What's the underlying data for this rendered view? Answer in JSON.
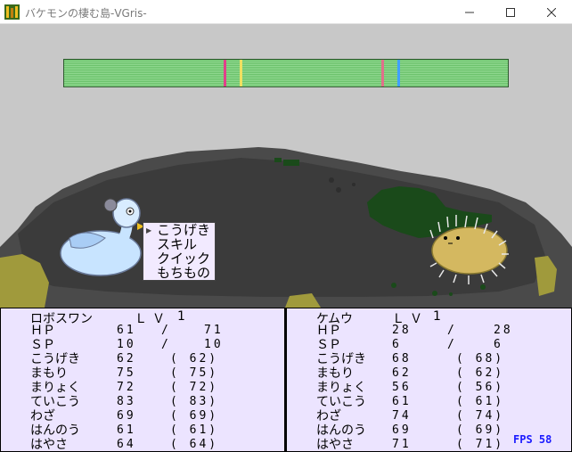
{
  "window": {
    "title": "バケモンの棲む島-VGris-"
  },
  "battle_menu": {
    "items": [
      "こうげき",
      "スキル",
      "クイック",
      "もちもの"
    ],
    "selected_index": 0
  },
  "player": {
    "name": "ロボスワン",
    "level_label": "ＬＶ",
    "level": "1",
    "stats": [
      {
        "label": "ＨＰ",
        "current": "61",
        "sep": "/",
        "max": "71"
      },
      {
        "label": "ＳＰ",
        "current": "10",
        "sep": "/",
        "max": "10"
      },
      {
        "label": "こうげき",
        "current": "62",
        "base": "( 62)"
      },
      {
        "label": "まもり",
        "current": "75",
        "base": "( 75)"
      },
      {
        "label": "まりょく",
        "current": "72",
        "base": "( 72)"
      },
      {
        "label": "ていこう",
        "current": "83",
        "base": "( 83)"
      },
      {
        "label": "わざ",
        "current": "69",
        "base": "( 69)"
      },
      {
        "label": "はんのう",
        "current": "61",
        "base": "( 61)"
      },
      {
        "label": "はやさ",
        "current": "64",
        "base": "( 64)"
      }
    ]
  },
  "enemy": {
    "name": "ケムウ",
    "level_label": "ＬＶ",
    "level": "1",
    "stats": [
      {
        "label": "ＨＰ",
        "current": "28",
        "sep": "/",
        "max": "28"
      },
      {
        "label": "ＳＰ",
        "current": "6",
        "sep": "/",
        "max": "6"
      },
      {
        "label": "こうげき",
        "current": "68",
        "base": "( 68)"
      },
      {
        "label": "まもり",
        "current": "62",
        "base": "( 62)"
      },
      {
        "label": "まりょく",
        "current": "56",
        "base": "( 56)"
      },
      {
        "label": "ていこう",
        "current": "61",
        "base": "( 61)"
      },
      {
        "label": "わざ",
        "current": "74",
        "base": "( 74)"
      },
      {
        "label": "はんのう",
        "current": "69",
        "base": "( 69)"
      },
      {
        "label": "はやさ",
        "current": "71",
        "base": "( 71)"
      }
    ]
  },
  "fps_text": "FPS 58",
  "gauge": {
    "markers": [
      {
        "name": "pink",
        "position": 0.36,
        "color": "#e0408a"
      },
      {
        "name": "yellow",
        "position": 0.395,
        "color": "#f0e060"
      },
      {
        "name": "pink2",
        "position": 0.715,
        "color": "#e0708a"
      },
      {
        "name": "blue",
        "position": 0.75,
        "color": "#40a0ff"
      }
    ]
  },
  "colors": {
    "panel_bg": "#ece4ff",
    "ground": "#4a4a4a",
    "fps": "#1a1aff"
  },
  "icons": [
    "app-icon",
    "minimize-icon",
    "maximize-icon",
    "close-icon",
    "menu-cursor-icon"
  ]
}
